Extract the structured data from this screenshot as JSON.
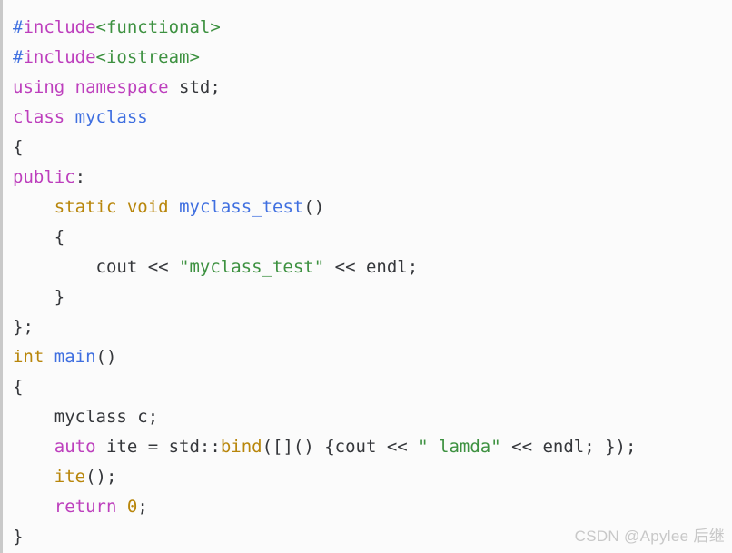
{
  "editor": {
    "background_color": "#fbfbfb",
    "left_border_color": "#c9c9c9",
    "language": "C++",
    "theme_colors": {
      "plain": "#35373b",
      "preprocessor_hash": "#3f6fe0",
      "preprocessor_keyword": "#bd3fbd",
      "header_name": "#3d9140",
      "keyword": "#bd3fbd",
      "type": "#b8860b",
      "class_name": "#3f6fe0",
      "function_name": "#3f6fe0",
      "function_call": "#b8860b",
      "string": "#3d9140",
      "number": "#b8860b"
    }
  },
  "code": {
    "lines": [
      {
        "n": 1,
        "text": "#include<functional>",
        "tokens": [
          {
            "t": "#",
            "c": "t-hash"
          },
          {
            "t": "include",
            "c": "t-pre"
          },
          {
            "t": "<functional>",
            "c": "t-header"
          }
        ]
      },
      {
        "n": 2,
        "text": "#include<iostream>",
        "tokens": [
          {
            "t": "#",
            "c": "t-hash"
          },
          {
            "t": "include",
            "c": "t-pre"
          },
          {
            "t": "<iostream>",
            "c": "t-header"
          }
        ]
      },
      {
        "n": 3,
        "text": "using namespace std;",
        "tokens": [
          {
            "t": "using namespace",
            "c": "t-kw"
          },
          {
            "t": " std;",
            "c": "t-plain"
          }
        ]
      },
      {
        "n": 4,
        "text": "class myclass",
        "tokens": [
          {
            "t": "class",
            "c": "t-kw"
          },
          {
            "t": " ",
            "c": "t-plain"
          },
          {
            "t": "myclass",
            "c": "t-cls"
          }
        ]
      },
      {
        "n": 5,
        "text": "{",
        "tokens": [
          {
            "t": "{",
            "c": "t-plain"
          }
        ]
      },
      {
        "n": 6,
        "text": "public:",
        "tokens": [
          {
            "t": "public",
            "c": "t-kw"
          },
          {
            "t": ":",
            "c": "t-plain"
          }
        ]
      },
      {
        "n": 7,
        "text": "    static void myclass_test()",
        "tokens": [
          {
            "t": "    ",
            "c": "t-plain"
          },
          {
            "t": "static void",
            "c": "t-type"
          },
          {
            "t": " ",
            "c": "t-plain"
          },
          {
            "t": "myclass_test",
            "c": "t-fn"
          },
          {
            "t": "()",
            "c": "t-plain"
          }
        ]
      },
      {
        "n": 8,
        "text": "    {",
        "tokens": [
          {
            "t": "    {",
            "c": "t-plain"
          }
        ]
      },
      {
        "n": 9,
        "text": "        cout << \"myclass_test\" << endl;",
        "tokens": [
          {
            "t": "        cout << ",
            "c": "t-plain"
          },
          {
            "t": "\"myclass_test\"",
            "c": "t-str"
          },
          {
            "t": " << endl;",
            "c": "t-plain"
          }
        ]
      },
      {
        "n": 10,
        "text": "    }",
        "tokens": [
          {
            "t": "    }",
            "c": "t-plain"
          }
        ]
      },
      {
        "n": 11,
        "text": "};",
        "tokens": [
          {
            "t": "};",
            "c": "t-plain"
          }
        ]
      },
      {
        "n": 12,
        "text": "int main()",
        "tokens": [
          {
            "t": "int",
            "c": "t-type"
          },
          {
            "t": " ",
            "c": "t-plain"
          },
          {
            "t": "main",
            "c": "t-fn"
          },
          {
            "t": "()",
            "c": "t-plain"
          }
        ]
      },
      {
        "n": 13,
        "text": "{",
        "tokens": [
          {
            "t": "{",
            "c": "t-plain"
          }
        ]
      },
      {
        "n": 14,
        "text": "    myclass c;",
        "tokens": [
          {
            "t": "    myclass c;",
            "c": "t-plain"
          }
        ]
      },
      {
        "n": 15,
        "text": "    auto ite = std::bind([]() {cout << \" lamda\" << endl; });",
        "tokens": [
          {
            "t": "    ",
            "c": "t-plain"
          },
          {
            "t": "auto",
            "c": "t-kw"
          },
          {
            "t": " ite = std::",
            "c": "t-plain"
          },
          {
            "t": "bind",
            "c": "t-call"
          },
          {
            "t": "([]() {cout << ",
            "c": "t-plain"
          },
          {
            "t": "\" lamda\"",
            "c": "t-str"
          },
          {
            "t": " << endl; });",
            "c": "t-plain"
          }
        ]
      },
      {
        "n": 16,
        "text": "    ite();",
        "tokens": [
          {
            "t": "    ",
            "c": "t-plain"
          },
          {
            "t": "ite",
            "c": "t-call"
          },
          {
            "t": "();",
            "c": "t-plain"
          }
        ]
      },
      {
        "n": 17,
        "text": "    return 0;",
        "tokens": [
          {
            "t": "    ",
            "c": "t-plain"
          },
          {
            "t": "return",
            "c": "t-kw"
          },
          {
            "t": " ",
            "c": "t-plain"
          },
          {
            "t": "0",
            "c": "t-num"
          },
          {
            "t": ";",
            "c": "t-plain"
          }
        ]
      },
      {
        "n": 18,
        "text": "}",
        "tokens": [
          {
            "t": "}",
            "c": "t-plain"
          }
        ]
      }
    ]
  },
  "watermark": {
    "text": "CSDN @Apylee 后继",
    "color": "#c8c8c8"
  }
}
